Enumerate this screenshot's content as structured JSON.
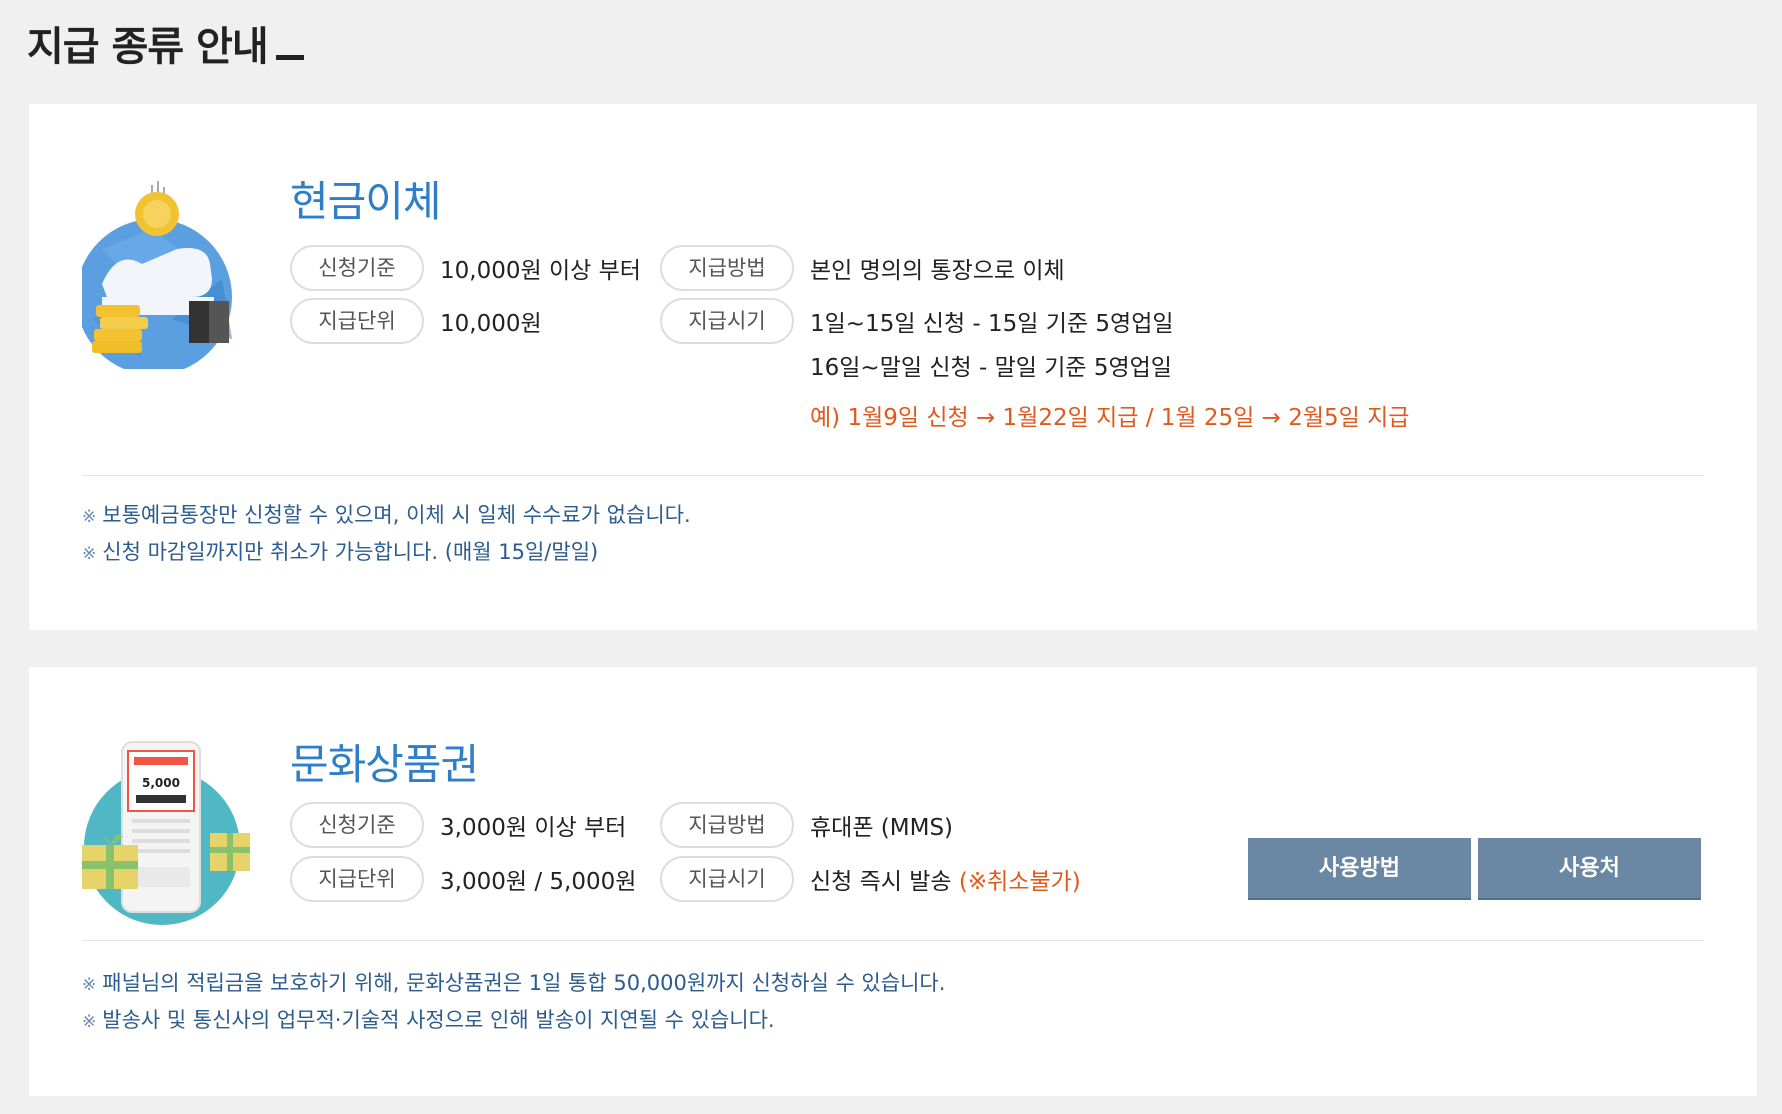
{
  "page_title": "지급 종류 안내",
  "cash": {
    "title": "현금이체",
    "criteria_label": "신청기준",
    "criteria_value": "10,000원 이상 부터",
    "unit_label": "지급단위",
    "unit_value": "10,000원",
    "method_label": "지급방법",
    "method_value": "본인 명의의 통장으로 이체",
    "timing_label": "지급시기",
    "timing_lines": [
      "1일~15일 신청 - 15일 기준 5영업일",
      "16일~말일 신청 - 말일 기준 5영업일"
    ],
    "example": "예) 1월9일 신청 → 1월22일 지급 / 1월 25일 → 2월5일 지급",
    "notes": [
      "보통예금통장만 신청할 수 있으며, 이체 시 일체 수수료가 없습니다.",
      "신청 마감일까지만 취소가 가능합니다. (매월 15일/말일)"
    ]
  },
  "voucher": {
    "title": "문화상품권",
    "criteria_label": "신청기준",
    "criteria_value": "3,000원 이상 부터",
    "unit_label": "지급단위",
    "unit_value": "3,000원 / 5,000원",
    "method_label": "지급방법",
    "method_value": "휴대폰 (MMS)",
    "timing_label": "지급시기",
    "timing_value": "신청 즉시 발송",
    "timing_warning": "(※취소불가)",
    "phone_amount": "5,000",
    "usage_button": "사용방법",
    "places_button": "사용처",
    "notes": [
      "패널님의 적립금을 보호하기 위해, 문화상품권은 1일 통합 50,000원까지 신청하실 수 있습니다.",
      "발송사 및 통신사의 업무적·기술적 사정으로 인해 발송이 지연될 수 있습니다."
    ]
  },
  "note_mark": "※",
  "colors": {
    "title_blue": "#2f7ec8",
    "warning_orange": "#e05a1e",
    "note_blue": "#2c5c8f",
    "button_bg": "#6a87a3"
  },
  "icons": {
    "cash": "cash-transfer-icon",
    "voucher": "gift-voucher-phone-icon"
  }
}
